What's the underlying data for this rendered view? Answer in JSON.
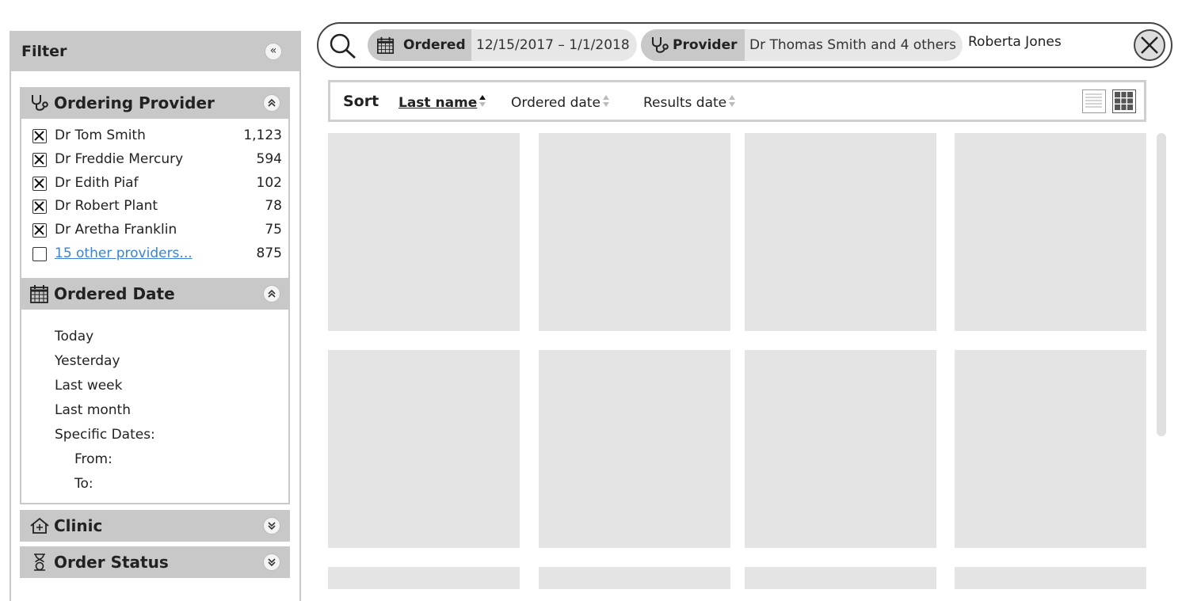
{
  "filter": {
    "title": "Filter",
    "collapse_glyph": "«",
    "sections": {
      "provider": {
        "title": "Ordering Provider",
        "icon": "stethoscope-icon",
        "toggle_glyph": "⌃",
        "expanded": true,
        "items": [
          {
            "label": "Dr Tom Smith",
            "count": "1,123",
            "checked": true
          },
          {
            "label": "Dr Freddie Mercury",
            "count": "594",
            "checked": true
          },
          {
            "label": "Dr Edith Piaf",
            "count": "102",
            "checked": true
          },
          {
            "label": "Dr Robert Plant",
            "count": "78",
            "checked": true
          },
          {
            "label": "Dr Aretha Franklin",
            "count": "75",
            "checked": true
          },
          {
            "label": "15 other providers...",
            "count": "875",
            "checked": false
          }
        ]
      },
      "ordered_date": {
        "title": "Ordered Date",
        "icon": "calendar-icon",
        "expanded": true,
        "options": [
          "Today",
          "Yesterday",
          "Last week",
          "Last month",
          "Specific Dates:"
        ],
        "from_label": "From:",
        "to_label": "To:"
      },
      "clinic": {
        "title": "Clinic",
        "icon": "clinic-icon",
        "expanded": false
      },
      "order_status": {
        "title": "Order Status",
        "icon": "hourglass-icon",
        "expanded": false
      }
    }
  },
  "search": {
    "chips": [
      {
        "key": "Ordered",
        "value": "12/15/2017 – 1/1/2018",
        "icon": "calendar-icon"
      },
      {
        "key": "Provider",
        "value": "Dr Thomas Smith and 4 others",
        "icon": "stethoscope-icon"
      }
    ],
    "query": "Roberta Jones"
  },
  "sort": {
    "label": "Sort",
    "options": [
      {
        "label": "Last name",
        "active": true,
        "direction": "asc"
      },
      {
        "label": "Ordered date",
        "active": false
      },
      {
        "label": "Results date",
        "active": false
      }
    ],
    "view_mode": "grid"
  },
  "colors": {
    "panel_gray": "#c8c8c8",
    "card_gray": "#e4e4e4",
    "link_blue": "#3a83d6"
  }
}
